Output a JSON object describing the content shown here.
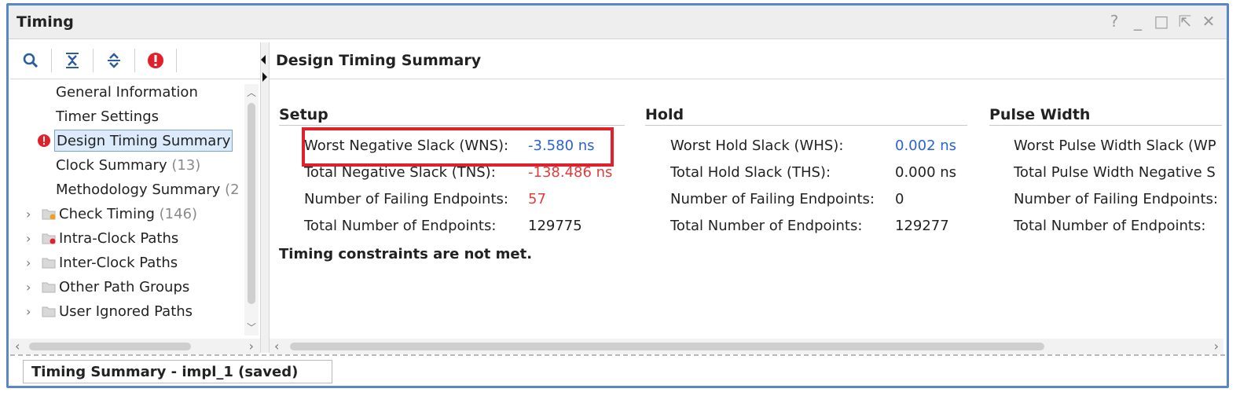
{
  "window": {
    "title": "Timing"
  },
  "tree": {
    "items": [
      {
        "label": "General Information",
        "count": ""
      },
      {
        "label": "Timer Settings",
        "count": ""
      },
      {
        "label": "Design Timing Summary",
        "count": ""
      },
      {
        "label": "Clock Summary",
        "count": "(13)"
      },
      {
        "label": "Methodology Summary",
        "count": "(2"
      },
      {
        "label": "Check Timing",
        "count": "(146)"
      },
      {
        "label": "Intra-Clock Paths",
        "count": ""
      },
      {
        "label": "Inter-Clock Paths",
        "count": ""
      },
      {
        "label": "Other Path Groups",
        "count": ""
      },
      {
        "label": "User Ignored Paths",
        "count": ""
      }
    ]
  },
  "summary": {
    "header": "Design Timing Summary",
    "setup": {
      "title": "Setup",
      "rows": [
        {
          "label": "Worst Negative Slack (WNS):",
          "value": "-3.580 ns"
        },
        {
          "label": "Total Negative Slack (TNS):",
          "value": "-138.486 ns"
        },
        {
          "label": "Number of Failing Endpoints:",
          "value": "57"
        },
        {
          "label": "Total Number of Endpoints:",
          "value": "129775"
        }
      ],
      "status": "Timing constraints are not met."
    },
    "hold": {
      "title": "Hold",
      "rows": [
        {
          "label": "Worst Hold Slack (WHS):",
          "value": "0.002 ns"
        },
        {
          "label": "Total Hold Slack (THS):",
          "value": "0.000 ns"
        },
        {
          "label": "Number of Failing Endpoints:",
          "value": "0"
        },
        {
          "label": "Total Number of Endpoints:",
          "value": "129277"
        }
      ]
    },
    "pulse": {
      "title": "Pulse Width",
      "rows": [
        {
          "label": "Worst Pulse Width Slack (WP"
        },
        {
          "label": "Total Pulse Width Negative S"
        },
        {
          "label": "Number of Failing Endpoints:"
        },
        {
          "label": "Total Number of Endpoints:"
        }
      ]
    }
  },
  "bottom_tab": {
    "label": "Timing Summary - impl_1 (saved)"
  },
  "colors": {
    "accent": "#5b86c5",
    "error": "#e0202a",
    "link": "#2a62d6"
  }
}
